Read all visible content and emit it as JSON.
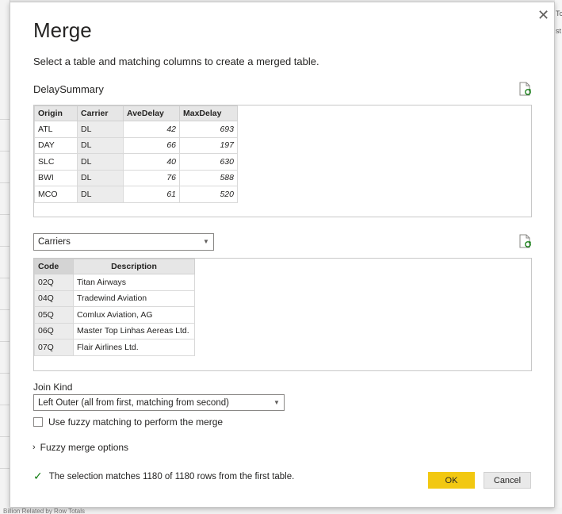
{
  "dialog": {
    "title": "Merge",
    "subtitle": "Select a table and matching columns to create a merged table.",
    "close_glyph": "✕"
  },
  "first_table": {
    "name": "DelaySummary",
    "columns": [
      "Origin",
      "Carrier",
      "AveDelay",
      "MaxDelay"
    ],
    "rows": [
      [
        "ATL",
        "DL",
        "42",
        "693"
      ],
      [
        "DAY",
        "DL",
        "66",
        "197"
      ],
      [
        "SLC",
        "DL",
        "40",
        "630"
      ],
      [
        "BWI",
        "DL",
        "76",
        "588"
      ],
      [
        "MCO",
        "DL",
        "61",
        "520"
      ]
    ]
  },
  "second_table": {
    "selected": "Carriers",
    "columns": [
      "Code",
      "Description"
    ],
    "rows": [
      [
        "02Q",
        "Titan Airways"
      ],
      [
        "04Q",
        "Tradewind Aviation"
      ],
      [
        "05Q",
        "Comlux Aviation, AG"
      ],
      [
        "06Q",
        "Master Top Linhas Aereas Ltd."
      ],
      [
        "07Q",
        "Flair Airlines Ltd."
      ]
    ]
  },
  "join": {
    "label": "Join Kind",
    "selected": "Left Outer (all from first, matching from second)"
  },
  "fuzzy_checkbox_label": "Use fuzzy matching to perform the merge",
  "fuzzy_options_label": "Fuzzy merge options",
  "status_text": "The selection matches 1180 of 1180 rows from the first table.",
  "buttons": {
    "ok": "OK",
    "cancel": "Cancel"
  },
  "background": {
    "right_letters": [
      "Tc",
      "st"
    ],
    "bottom_text": "Billion Related by Row Totals"
  },
  "icons": {
    "refresh": "refresh-preview-icon",
    "status": "checkmark-icon",
    "close": "close-icon",
    "dropdown": "chevron-down-icon",
    "expand": "chevron-right-icon"
  },
  "colors": {
    "ok_button": "#f2c811",
    "status_check": "#107c10"
  }
}
